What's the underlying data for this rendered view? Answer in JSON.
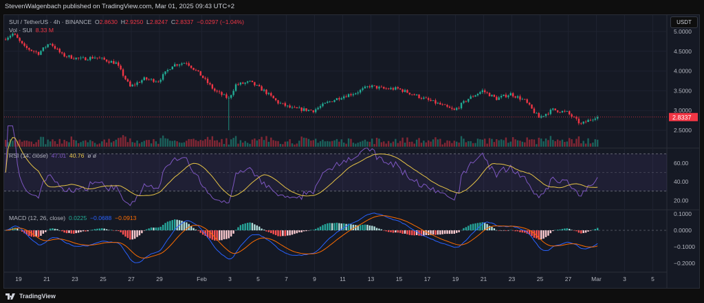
{
  "header": {
    "published": "StevenWalgenbach published on TradingView.com, Mar 01, 2025 09:43 UTC+2"
  },
  "legend": {
    "symbol": "SUI / TetherUS · 4h · BINANCE",
    "o_label": "O",
    "o": "2.8630",
    "h_label": "H",
    "h": "2.9250",
    "l_label": "L",
    "l": "2.8247",
    "c_label": "C",
    "c": "2.8337",
    "change": "−0.0297 (−1.04%)",
    "vol_label": "Vol · SUI",
    "vol": "8.33 M",
    "rsi_label": "RSI (14, close)",
    "rsi": "47.01",
    "rsi_ma": "40.76",
    "rsi_extra": "ø  ø",
    "macd_label": "MACD (12, 26, close)",
    "macd_hist": "0.0225",
    "macd": "−0.0688",
    "macd_signal": "−0.0913"
  },
  "currency": "USDT",
  "last_price": "2.8337",
  "footer": {
    "brand": "TradingView"
  },
  "colors": {
    "up": "#22ab94",
    "down": "#f23645",
    "rsi": "#7e57c2",
    "rsi_ma": "#e8c547",
    "macd": "#2962ff",
    "signal": "#ff6d00"
  },
  "chart_data": {
    "type": "candlestick",
    "interval": "4h",
    "price_ticks": [
      "5.0000",
      "4.5000",
      "4.0000",
      "3.5000",
      "3.0000",
      "2.5000"
    ],
    "rsi_ticks": [
      "60.00",
      "40.00",
      "20.00"
    ],
    "macd_ticks": [
      "0.1000",
      "0.0000",
      "−0.1000",
      "−0.2000"
    ],
    "x_ticks": [
      "19",
      "21",
      "23",
      "25",
      "27",
      "29",
      "Feb",
      "3",
      "5",
      "7",
      "9",
      "11",
      "13",
      "15",
      "17",
      "19",
      "21",
      "23",
      "25",
      "27",
      "Mar",
      "3",
      "5"
    ],
    "x_tick_days": [
      1,
      3,
      5,
      7,
      9,
      11,
      14,
      16,
      18,
      20,
      22,
      24,
      26,
      28,
      30,
      32,
      34,
      36,
      38,
      40,
      42,
      44,
      46
    ],
    "start": "Jan 18",
    "close_keypoints_by_day": [
      [
        0,
        4.8
      ],
      [
        0.7,
        4.95
      ],
      [
        1.5,
        4.6
      ],
      [
        2.5,
        4.45
      ],
      [
        3.3,
        4.72
      ],
      [
        4.2,
        4.4
      ],
      [
        5.5,
        4.3
      ],
      [
        6.5,
        4.35
      ],
      [
        8,
        4.2
      ],
      [
        9,
        3.6
      ],
      [
        10,
        3.8
      ],
      [
        11,
        3.75
      ],
      [
        12,
        4.15
      ],
      [
        13,
        4.22
      ],
      [
        14,
        3.9
      ],
      [
        15,
        3.5
      ],
      [
        16,
        3.3
      ],
      [
        16.5,
        3.65
      ],
      [
        17.5,
        3.72
      ],
      [
        18.5,
        3.5
      ],
      [
        19.5,
        3.2
      ],
      [
        20.5,
        3.05
      ],
      [
        22,
        3.0
      ],
      [
        23,
        3.2
      ],
      [
        24,
        3.35
      ],
      [
        25,
        3.45
      ],
      [
        26,
        3.62
      ],
      [
        27,
        3.55
      ],
      [
        28,
        3.55
      ],
      [
        29,
        3.42
      ],
      [
        30,
        3.28
      ],
      [
        31,
        3.15
      ],
      [
        32,
        3.0
      ],
      [
        33,
        3.3
      ],
      [
        34,
        3.5
      ],
      [
        35,
        3.3
      ],
      [
        36,
        3.42
      ],
      [
        37,
        3.25
      ],
      [
        38,
        2.82
      ],
      [
        39,
        3.02
      ],
      [
        40,
        2.95
      ],
      [
        41,
        2.65
      ],
      [
        42,
        2.84
      ],
      [
        42.3,
        2.8337
      ]
    ]
  }
}
